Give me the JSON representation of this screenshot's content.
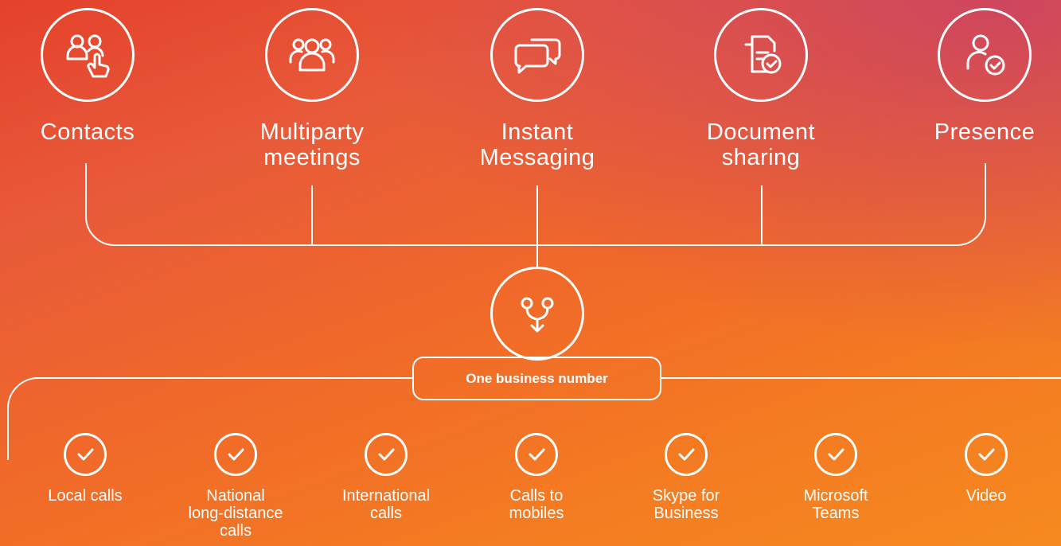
{
  "features": [
    {
      "id": "contacts",
      "label_lines": [
        "Contacts"
      ],
      "icon": "contacts-icon"
    },
    {
      "id": "multiparty",
      "label_lines": [
        "Multiparty",
        "meetings"
      ],
      "icon": "group-icon"
    },
    {
      "id": "im",
      "label_lines": [
        "Instant",
        "Messaging"
      ],
      "icon": "chat-bubbles-icon"
    },
    {
      "id": "docs",
      "label_lines": [
        "Document",
        "sharing"
      ],
      "icon": "document-check-icon"
    },
    {
      "id": "presence",
      "label_lines": [
        "Presence"
      ],
      "icon": "person-check-icon"
    }
  ],
  "hub": {
    "icon": "merge-arrow-icon",
    "label": "One business number"
  },
  "capabilities": [
    {
      "label_lines": [
        "Local calls"
      ]
    },
    {
      "label_lines": [
        "National",
        "long-distance",
        "calls"
      ]
    },
    {
      "label_lines": [
        "International",
        "calls"
      ]
    },
    {
      "label_lines": [
        "Calls to",
        "mobiles"
      ]
    },
    {
      "label_lines": [
        "Skype for",
        "Business"
      ]
    },
    {
      "label_lines": [
        "Microsoft",
        "Teams"
      ]
    },
    {
      "label_lines": [
        "Video"
      ]
    }
  ],
  "colors": {
    "line": "#ffffff",
    "bg_start": "#e4412b",
    "bg_end": "#f68a1f",
    "accent_top_right": "#c43c6e"
  }
}
